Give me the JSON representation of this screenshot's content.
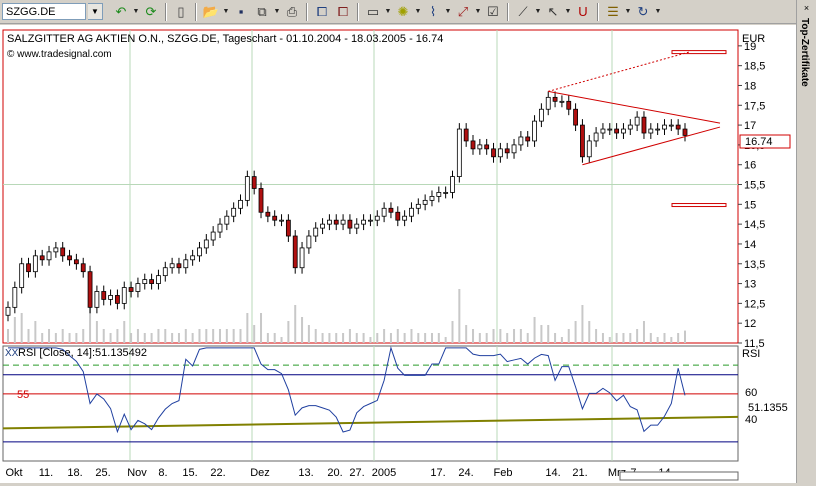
{
  "toolbar": {
    "symbol": "SZGG.DE",
    "buttons": [
      {
        "name": "back-icon",
        "glyph": "↶",
        "color": "#1b8a1b"
      },
      {
        "name": "refresh-icon",
        "glyph": "⟳",
        "color": "#1b8a1b"
      },
      {
        "name": "new-document-icon",
        "glyph": "▯",
        "color": "#444"
      },
      {
        "name": "open-folder-icon",
        "glyph": "📂",
        "color": "#c89a1a"
      },
      {
        "name": "save-icon",
        "glyph": "▪",
        "color": "#203060"
      },
      {
        "name": "copy-icon",
        "glyph": "⧉",
        "color": "#333"
      },
      {
        "name": "print-icon",
        "glyph": "⎙",
        "color": "#333"
      },
      {
        "name": "chart-window-icon",
        "glyph": "⧠",
        "color": "#204080"
      },
      {
        "name": "chart-compare-icon",
        "glyph": "⧠",
        "color": "#802020"
      },
      {
        "name": "layout-icon",
        "glyph": "▭",
        "color": "#333"
      },
      {
        "name": "indicator-icon",
        "glyph": "✺",
        "color": "#a0a000"
      },
      {
        "name": "trend-icon",
        "glyph": "⌇",
        "color": "#204080"
      },
      {
        "name": "drawing-icon",
        "glyph": "⤢",
        "color": "#a02020"
      },
      {
        "name": "properties-icon",
        "glyph": "☑",
        "color": "#333"
      },
      {
        "name": "line-tool-icon",
        "glyph": "⟋",
        "color": "#333"
      },
      {
        "name": "cursor-icon",
        "glyph": "↖",
        "color": "#333"
      },
      {
        "name": "magnet-icon",
        "glyph": "U",
        "color": "#b00000"
      },
      {
        "name": "notes-icon",
        "glyph": "☰",
        "color": "#806000"
      },
      {
        "name": "reload-icon",
        "glyph": "↻",
        "color": "#204080"
      }
    ]
  },
  "side_tab": {
    "label": "Top-Zertifikate",
    "close": "×"
  },
  "chart_data": [
    {
      "type": "candlestick",
      "title": "SALZGITTER AG AKTIEN O.N., SZGG.DE, Tageschart - 01.10.2004 - 18.03.2005 - 16.74",
      "source": "© www.tradesignal.com",
      "unit": "EUR",
      "ylim": [
        11.5,
        19.4
      ],
      "y_ticks": [
        "11,5",
        "12",
        "12,5",
        "13",
        "13,5",
        "14",
        "14,5",
        "15",
        "15,5",
        "16",
        "16,5",
        "17",
        "17,5",
        "18",
        "18,5",
        "19"
      ],
      "last_price": "16.74",
      "x_ticks": [
        "Okt",
        "11.",
        "18.",
        "25.",
        "Nov",
        "8.",
        "15.",
        "22.",
        "Dez",
        "13.",
        "20.",
        "27.",
        "2005",
        "17.",
        "24.",
        "Feb",
        "14.",
        "21.",
        "Mrz",
        "7.",
        "14."
      ],
      "series": [
        {
          "values": [
            12.4,
            12.9,
            13.5,
            13.3,
            13.7,
            13.6,
            13.8,
            13.9,
            13.7,
            13.6,
            13.5,
            13.3,
            12.4,
            12.8,
            12.6,
            12.7,
            12.5,
            12.9,
            12.8,
            13.0,
            13.1,
            13.0,
            13.2,
            13.4,
            13.5,
            13.4,
            13.6,
            13.7,
            13.9,
            14.1,
            14.3,
            14.5,
            14.7,
            14.9,
            15.1,
            15.7,
            15.4,
            14.8,
            14.7,
            14.6,
            14.6,
            14.2,
            13.4,
            13.9,
            14.2,
            14.4,
            14.5,
            14.6,
            14.5,
            14.6,
            14.4,
            14.5,
            14.6,
            14.6,
            14.7,
            14.9,
            14.8,
            14.6,
            14.7,
            14.9,
            15.0,
            15.1,
            15.2,
            15.3,
            15.3,
            15.7,
            16.9,
            16.6,
            16.4,
            16.5,
            16.4,
            16.2,
            16.4,
            16.3,
            16.5,
            16.7,
            16.6,
            17.1,
            17.4,
            17.7,
            17.6,
            17.6,
            17.4,
            17.0,
            16.2,
            16.6,
            16.8,
            16.9,
            16.9,
            16.8,
            16.9,
            17.0,
            17.2,
            16.8,
            16.9,
            16.9,
            17.0,
            17.0,
            16.9,
            16.74
          ]
        }
      ],
      "volume_note": "volume bars shown in lower band",
      "annotations": {
        "triangle": "converging trendlines",
        "target_lines": [
          "18.85",
          "15.0"
        ]
      }
    },
    {
      "type": "line",
      "title": "RSI [Close, 14]:51.135492",
      "unit": "RSI",
      "y_ticks": [
        "60",
        "40"
      ],
      "level_label": "55",
      "last_value": "51.1355",
      "ylim": [
        20,
        80
      ]
    }
  ]
}
